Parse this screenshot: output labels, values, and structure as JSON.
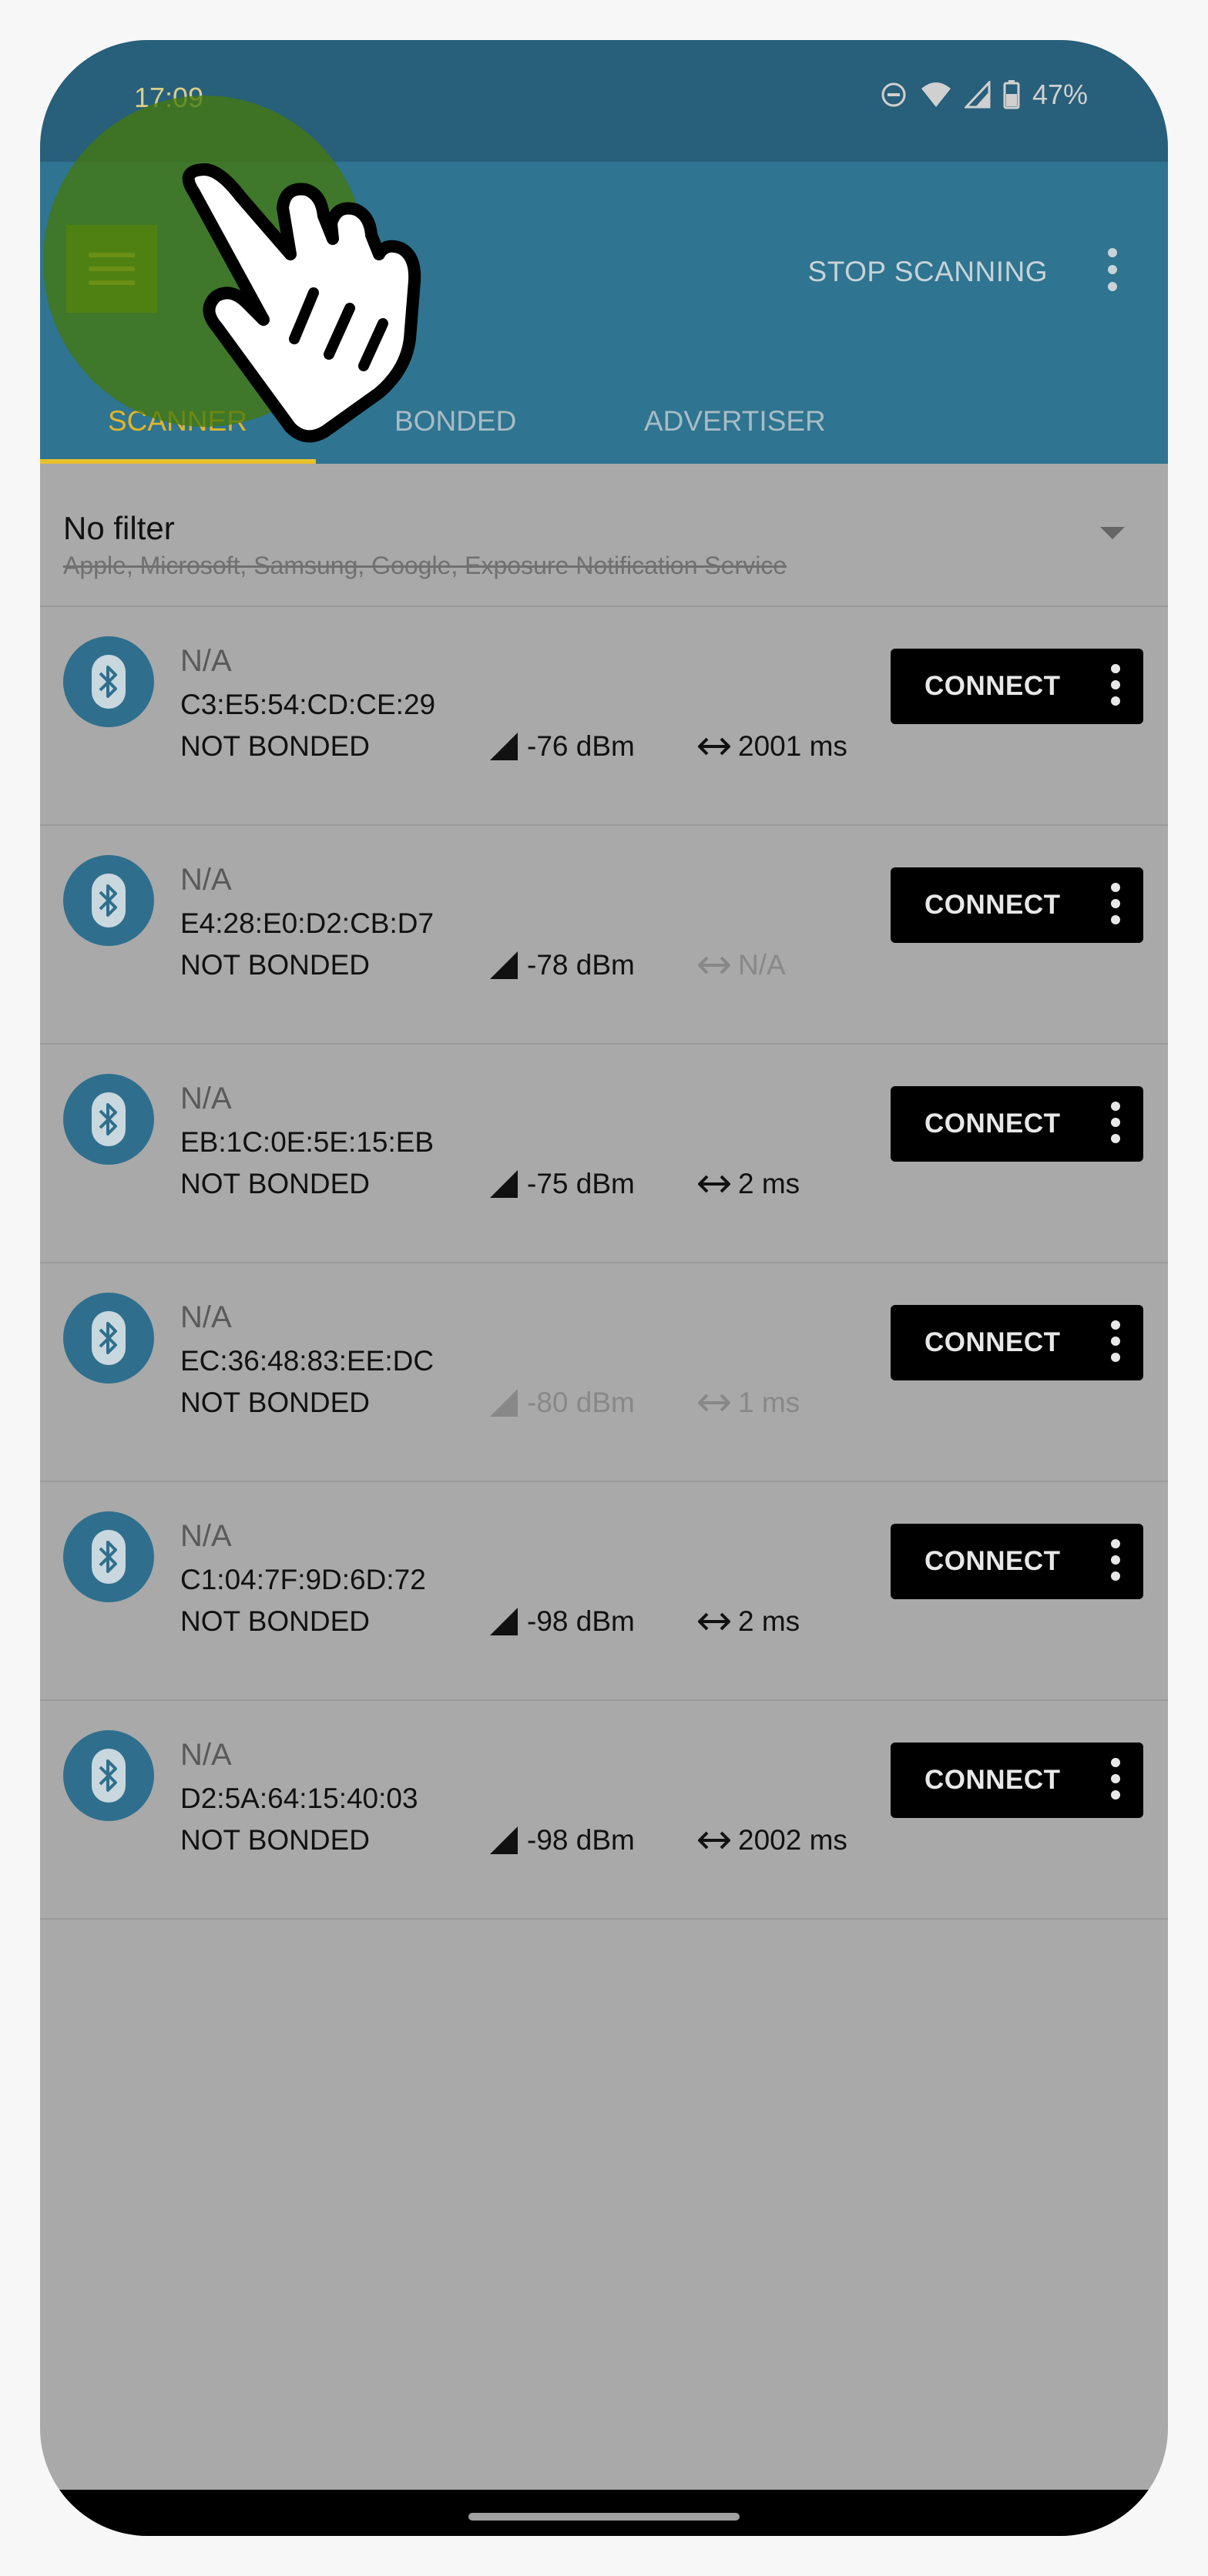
{
  "status_bar": {
    "time": "17:09",
    "battery": "47%"
  },
  "app_bar": {
    "stop_label": "STOP SCANNING",
    "tabs": [
      {
        "label": "SCANNER"
      },
      {
        "label": "BONDED"
      },
      {
        "label": "ADVERTISER"
      }
    ]
  },
  "filter": {
    "title": "No filter",
    "subtitle": "Apple, Microsoft, Samsung, Google, Exposure Notification Service"
  },
  "devices": [
    {
      "name": "N/A",
      "address": "C3:E5:54:CD:CE:29",
      "bond": "NOT BONDED",
      "rssi": "-76 dBm",
      "interval": "2001 ms",
      "connect": "CONNECT"
    },
    {
      "name": "N/A",
      "address": "E4:28:E0:D2:CB:D7",
      "bond": "NOT BONDED",
      "rssi": "-78 dBm",
      "interval": "N/A",
      "connect": "CONNECT"
    },
    {
      "name": "N/A",
      "address": "EB:1C:0E:5E:15:EB",
      "bond": "NOT BONDED",
      "rssi": "-75 dBm",
      "interval": "2 ms",
      "connect": "CONNECT"
    },
    {
      "name": "N/A",
      "address": "EC:36:48:83:EE:DC",
      "bond": "NOT BONDED",
      "rssi": "-80 dBm",
      "interval": "1 ms",
      "connect": "CONNECT"
    },
    {
      "name": "N/A",
      "address": "C1:04:7F:9D:6D:72",
      "bond": "NOT BONDED",
      "rssi": "-98 dBm",
      "interval": "2 ms",
      "connect": "CONNECT"
    },
    {
      "name": "N/A",
      "address": "D2:5A:64:15:40:03",
      "bond": "NOT BONDED",
      "rssi": "-98 dBm",
      "interval": "2002 ms",
      "connect": "CONNECT"
    }
  ],
  "colors": {
    "app_bar": "#2f7490",
    "status_bar": "#285f7a",
    "accent": "#e7c02c",
    "device_icon": "#2f6f8d"
  }
}
